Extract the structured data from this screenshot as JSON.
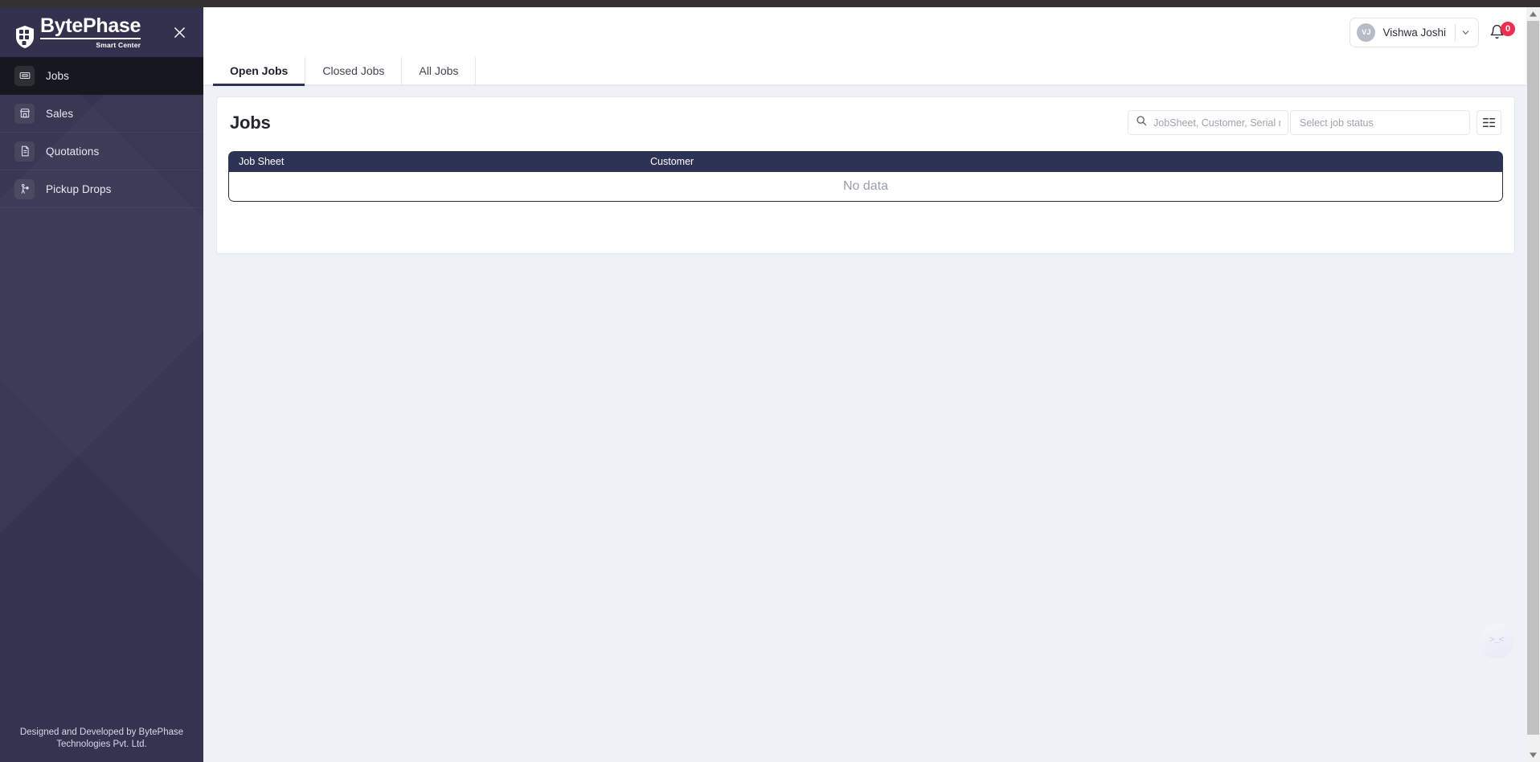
{
  "colors": {
    "sidebar_bg": "#343450",
    "sidebar_header_bg": "#32324e",
    "active_item_bg": "#17171f",
    "table_header_bg": "#2d3355",
    "accent": "#2d3355",
    "badge_red": "#ed2e4f",
    "content_bg": "#eef1f6"
  },
  "sidebar": {
    "brand": {
      "name": "BytePhase",
      "tagline": "Smart Center",
      "logo_icon": "shield-blocks-icon"
    },
    "close_icon": "close-icon",
    "items": [
      {
        "label": "Jobs",
        "icon": "ticket-icon",
        "active": true
      },
      {
        "label": "Sales",
        "icon": "store-icon",
        "active": false
      },
      {
        "label": "Quotations",
        "icon": "document-icon",
        "active": false
      },
      {
        "label": "Pickup Drops",
        "icon": "pickup-drop-icon",
        "active": false
      }
    ],
    "footer": "Designed and Developed by BytePhase Technologies Pvt. Ltd."
  },
  "topbar": {
    "user": {
      "initials": "VJ",
      "name": "Vishwa Joshi",
      "caret_icon": "chevron-down-icon"
    },
    "notifications": {
      "icon": "bell-icon",
      "count": "0"
    }
  },
  "main": {
    "tabs": [
      {
        "label": "Open Jobs",
        "active": true
      },
      {
        "label": "Closed Jobs",
        "active": false
      },
      {
        "label": "All Jobs",
        "active": false
      }
    ],
    "page_title": "Jobs",
    "toolbar": {
      "search": {
        "icon": "search-icon",
        "value": "",
        "placeholder": "JobSheet, Customer, Serial nu..."
      },
      "status_filter": {
        "placeholder": "Select job status",
        "value": ""
      },
      "view_toggle": {
        "icon": "list-view-icon",
        "label": "Toggle column view"
      }
    },
    "table": {
      "columns": [
        {
          "label": "Job Sheet"
        },
        {
          "label": "Customer"
        }
      ],
      "rows": [],
      "empty_text": "No data"
    }
  },
  "overlays": {
    "chat_widget": {
      "label": ">_<",
      "icon": "chat-bubble-icon"
    },
    "scrollbar": {
      "up_icon": "scroll-up-icon",
      "down_icon": "scroll-down-icon"
    }
  }
}
